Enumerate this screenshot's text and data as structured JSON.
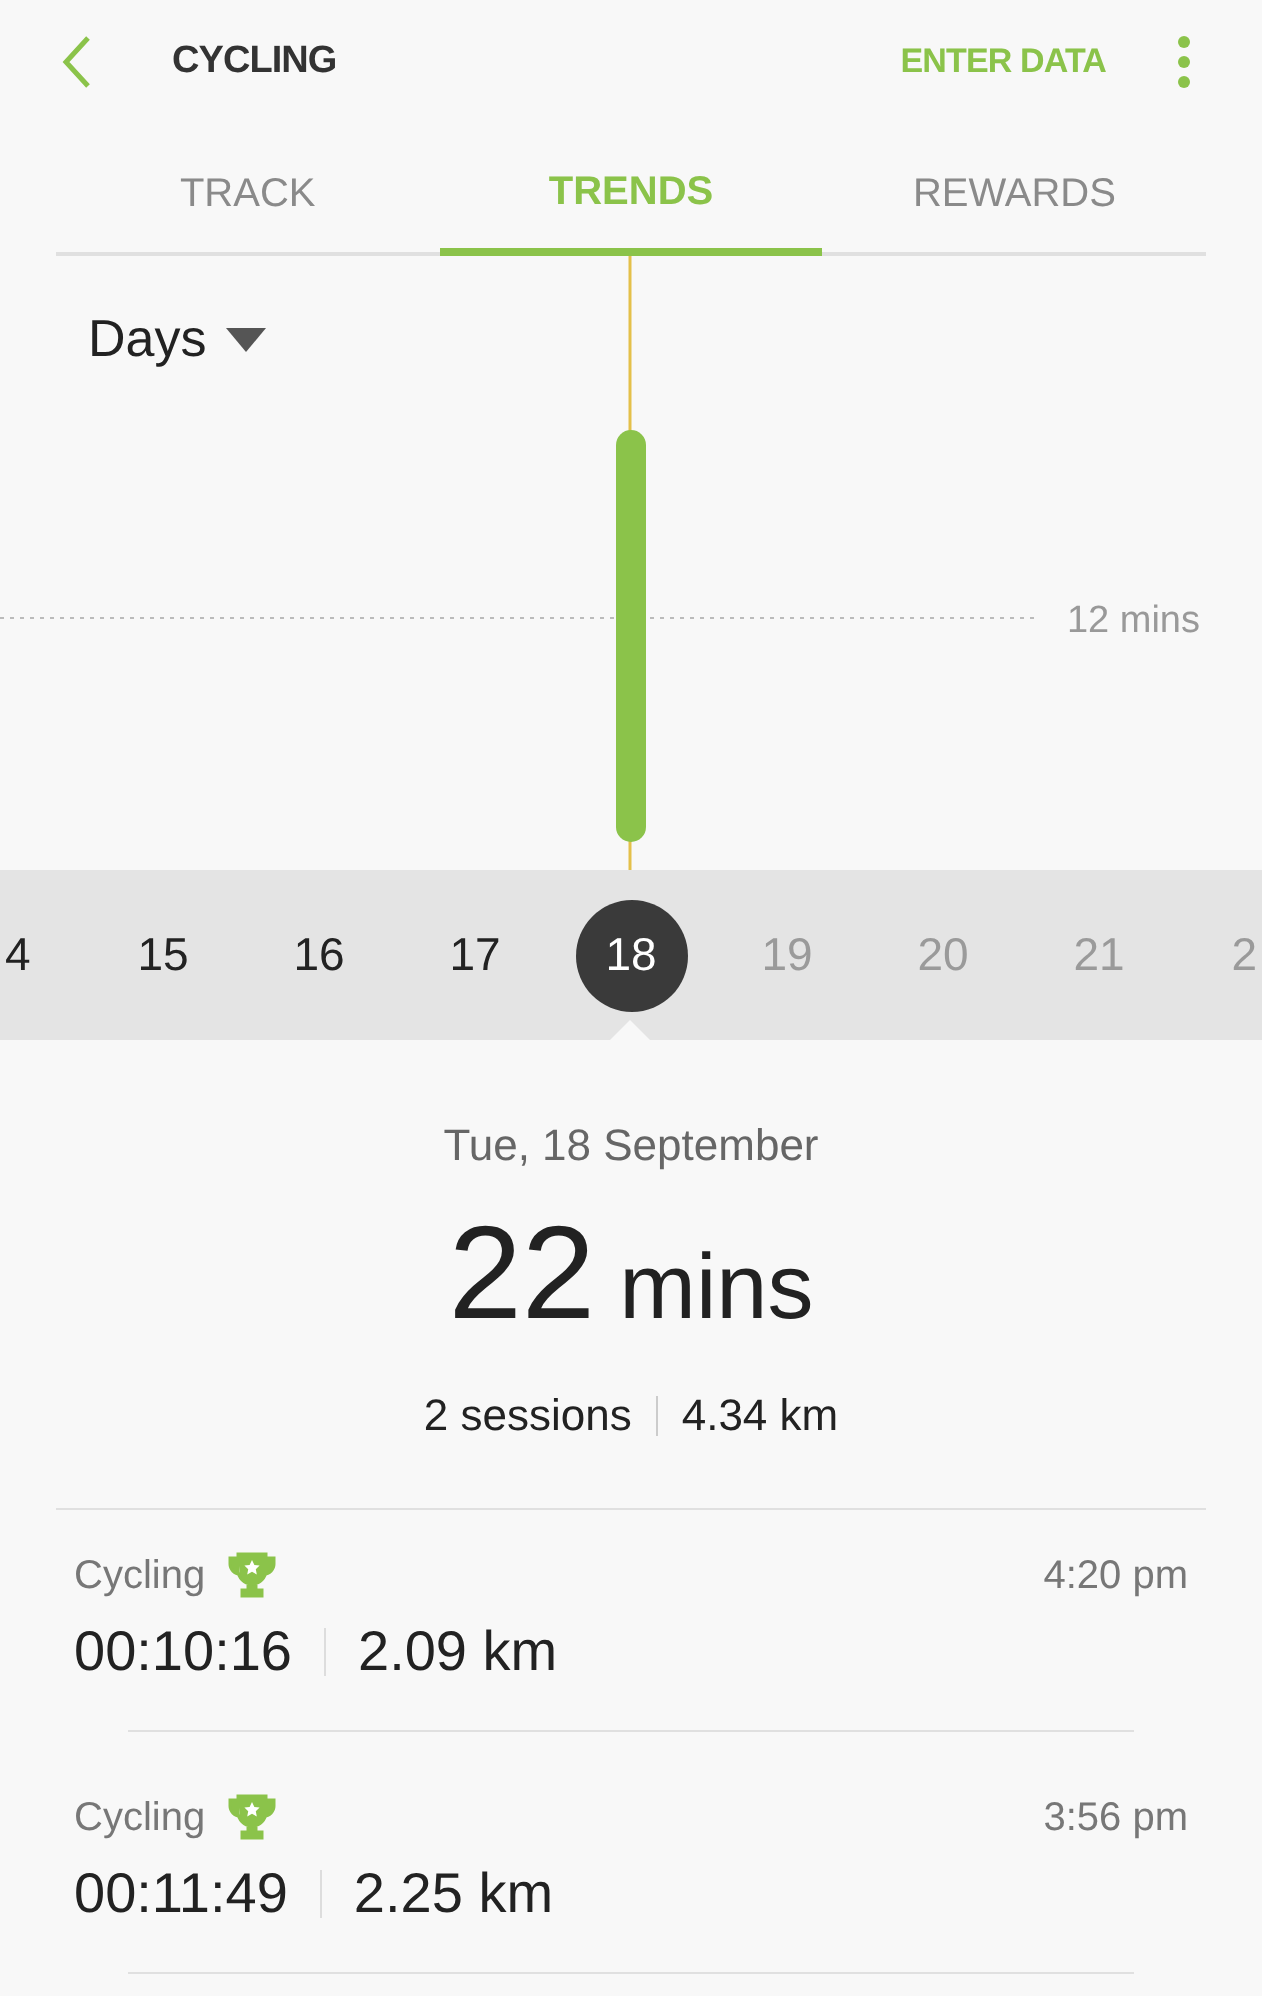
{
  "header": {
    "title": "CYCLING",
    "action": "ENTER DATA"
  },
  "tabs": [
    {
      "label": "TRACK",
      "selected": false
    },
    {
      "label": "TRENDS",
      "selected": true
    },
    {
      "label": "REWARDS",
      "selected": false
    }
  ],
  "period": {
    "value": "Days"
  },
  "chart": {
    "reference_label": "12 mins"
  },
  "days": [
    {
      "label": "4",
      "selected": false,
      "dimmed": false,
      "kind": "edge-left"
    },
    {
      "label": "15",
      "selected": false,
      "dimmed": false,
      "kind": "day"
    },
    {
      "label": "16",
      "selected": false,
      "dimmed": false,
      "kind": "day"
    },
    {
      "label": "17",
      "selected": false,
      "dimmed": false,
      "kind": "day"
    },
    {
      "label": "18",
      "selected": true,
      "dimmed": false,
      "kind": "day"
    },
    {
      "label": "19",
      "selected": false,
      "dimmed": true,
      "kind": "day"
    },
    {
      "label": "20",
      "selected": false,
      "dimmed": true,
      "kind": "day"
    },
    {
      "label": "21",
      "selected": false,
      "dimmed": true,
      "kind": "day"
    },
    {
      "label": "2",
      "selected": false,
      "dimmed": true,
      "kind": "edge-right"
    }
  ],
  "summary": {
    "date": "Tue, 18 September",
    "value": "22",
    "unit": "mins",
    "sessions": "2 sessions",
    "distance": "4.34 km"
  },
  "sessions": [
    {
      "name": "Cycling",
      "time": "4:20 pm",
      "duration": "00:10:16",
      "distance": "2.09 km"
    },
    {
      "name": "Cycling",
      "time": "3:56 pm",
      "duration": "00:11:49",
      "distance": "2.25 km"
    }
  ]
}
